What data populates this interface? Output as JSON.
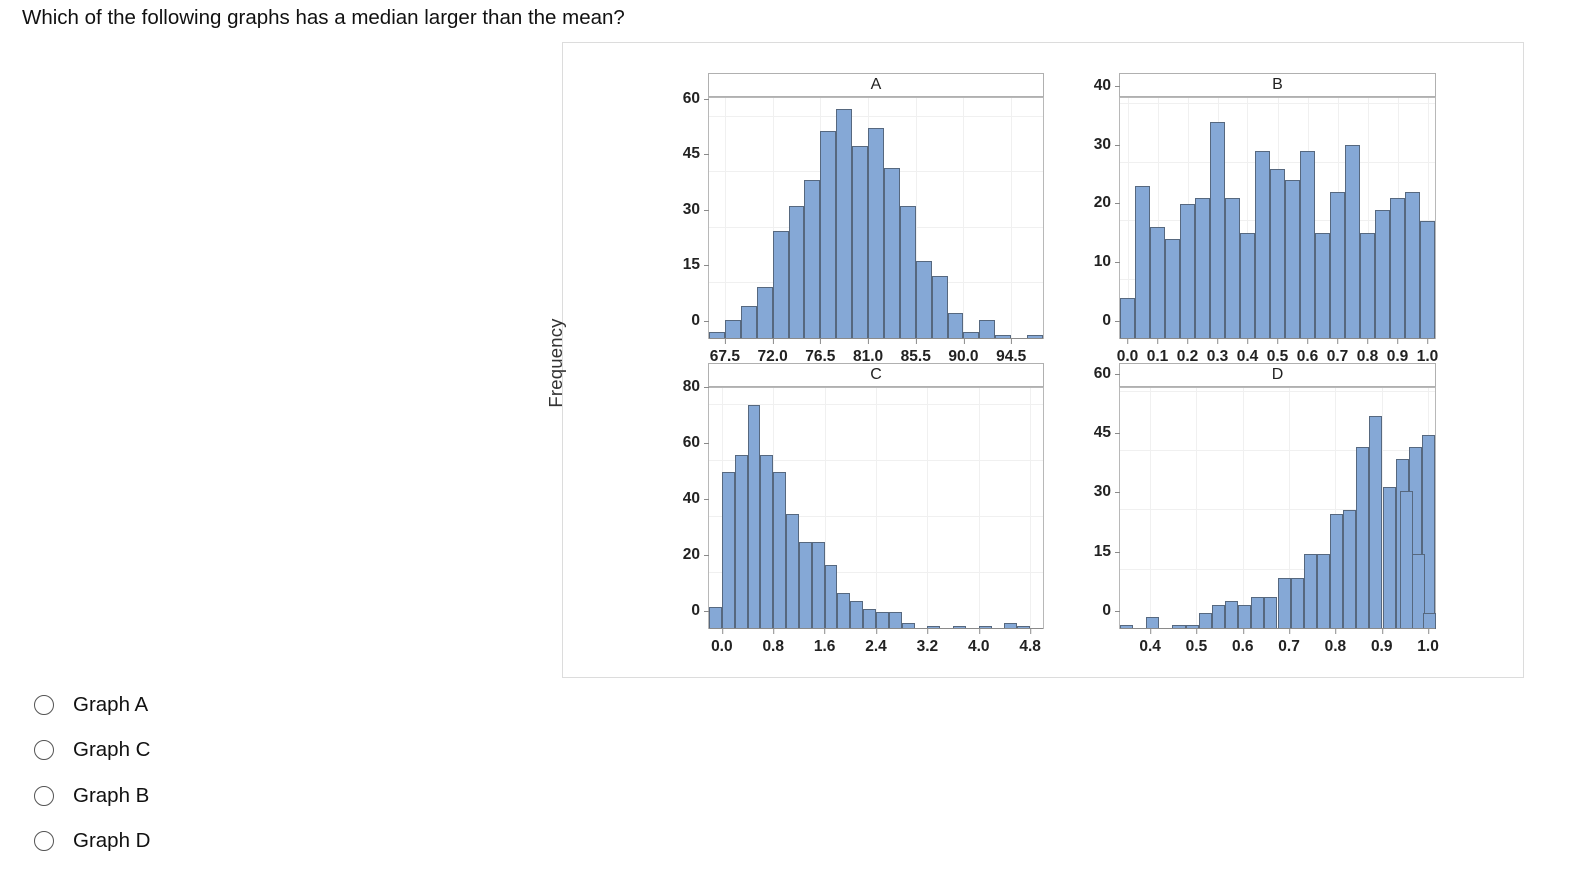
{
  "question": {
    "text": "Which of the following graphs has a median larger than the mean?"
  },
  "figure": {
    "y_axis_title": "Frequency"
  },
  "options": [
    {
      "label": "Graph A",
      "selected": false
    },
    {
      "label": "Graph C",
      "selected": false
    },
    {
      "label": "Graph B",
      "selected": false
    },
    {
      "label": "Graph D",
      "selected": false
    }
  ],
  "colors": {
    "bar_fill": "#85a8d6",
    "bar_stroke": "#56687f",
    "panel_border": "#dcdcdc",
    "grid": "#f0f0f0"
  },
  "chart_data": [
    {
      "type": "bar",
      "title": "A",
      "xlabel": "",
      "ylabel": "Frequency",
      "ylim": [
        0,
        65
      ],
      "yticks": [
        0,
        15,
        30,
        45,
        60
      ],
      "ytick_labels": [
        "0",
        "15",
        "30",
        "45",
        "60"
      ],
      "xlim": [
        66.0,
        97.5
      ],
      "xticks": [
        67.5,
        72.0,
        76.5,
        81.0,
        85.5,
        90.0,
        94.5
      ],
      "xtick_labels": [
        "67.5",
        "72.0",
        "76.5",
        "81.0",
        "85.5",
        "90.0",
        "94.5"
      ],
      "grid": true,
      "bin_width": 1.5,
      "bin_starts": [
        66.0,
        67.5,
        69.0,
        70.5,
        72.0,
        73.5,
        75.0,
        76.5,
        78.0,
        79.5,
        81.0,
        82.5,
        84.0,
        85.5,
        87.0,
        88.5,
        90.0,
        91.5,
        93.0,
        94.5,
        96.0
      ],
      "values": [
        2,
        5,
        9,
        14,
        29,
        36,
        43,
        56,
        62,
        52,
        57,
        46,
        36,
        21,
        17,
        7,
        2,
        5,
        1,
        0,
        1
      ]
    },
    {
      "type": "bar",
      "title": "B",
      "xlabel": "",
      "ylabel": "Frequency",
      "ylim": [
        0,
        41
      ],
      "yticks": [
        0,
        10,
        20,
        30,
        40
      ],
      "ytick_labels": [
        "0",
        "10",
        "20",
        "30",
        "40"
      ],
      "xlim": [
        -0.025,
        1.025
      ],
      "xticks": [
        0.0,
        0.1,
        0.2,
        0.3,
        0.4,
        0.5,
        0.6,
        0.7,
        0.8,
        0.9,
        1.0
      ],
      "xtick_labels": [
        "0.0",
        "0.1",
        "0.2",
        "0.3",
        "0.4",
        "0.5",
        "0.6",
        "0.7",
        "0.8",
        "0.9",
        "1.0"
      ],
      "grid": true,
      "bin_width": 0.05,
      "bin_starts": [
        -0.025,
        0.025,
        0.075,
        0.125,
        0.175,
        0.225,
        0.275,
        0.325,
        0.375,
        0.425,
        0.475,
        0.525,
        0.575,
        0.625,
        0.675,
        0.725,
        0.775,
        0.825,
        0.875,
        0.925,
        0.975
      ],
      "values": [
        7,
        26,
        19,
        17,
        23,
        24,
        37,
        24,
        18,
        32,
        29,
        27,
        32,
        18,
        25,
        33,
        18,
        22,
        24,
        25,
        20
      ]
    },
    {
      "type": "bar",
      "title": "C",
      "xlabel": "",
      "ylabel": "Frequency",
      "ylim": [
        0,
        86
      ],
      "yticks": [
        0,
        20,
        40,
        60,
        80
      ],
      "ytick_labels": [
        "0",
        "20",
        "40",
        "60",
        "80"
      ],
      "xlim": [
        -0.2,
        5.0
      ],
      "xticks": [
        0.0,
        0.8,
        1.6,
        2.4,
        3.2,
        4.0,
        4.8
      ],
      "xtick_labels": [
        "0.0",
        "0.8",
        "1.6",
        "2.4",
        "3.2",
        "4.0",
        "4.8"
      ],
      "grid": true,
      "bin_width": 0.2,
      "bin_starts": [
        -0.2,
        0.0,
        0.2,
        0.4,
        0.6,
        0.8,
        1.0,
        1.2,
        1.4,
        1.6,
        1.8,
        2.0,
        2.2,
        2.4,
        2.6,
        2.8,
        3.0,
        3.2,
        3.4,
        3.6,
        3.8,
        4.0,
        4.2,
        4.4,
        4.6
      ],
      "values": [
        8,
        56,
        62,
        80,
        62,
        56,
        41,
        31,
        31,
        23,
        13,
        10,
        7,
        6,
        6,
        2,
        0,
        1,
        0,
        1,
        0,
        1,
        0,
        2,
        1
      ]
    },
    {
      "type": "bar",
      "title": "D",
      "xlabel": "",
      "ylabel": "Frequency",
      "ylim": [
        0,
        61
      ],
      "yticks": [
        0,
        15,
        30,
        45,
        60
      ],
      "ytick_labels": [
        "0",
        "15",
        "30",
        "45",
        "60"
      ],
      "xlim": [
        0.335,
        1.015
      ],
      "xticks": [
        0.4,
        0.5,
        0.6,
        0.7,
        0.8,
        0.9,
        1.0
      ],
      "xtick_labels": [
        "0.4",
        "0.5",
        "0.6",
        "0.7",
        "0.8",
        "0.9",
        "1.0"
      ],
      "grid": true,
      "bin_width": 0.0283,
      "bin_starts": [
        0.335,
        0.3633,
        0.3917,
        0.42,
        0.4483,
        0.4767,
        0.505,
        0.5333,
        0.5617,
        0.59,
        0.6183,
        0.6467,
        0.675,
        0.7033,
        0.7317,
        0.76,
        0.7883,
        0.8167,
        0.845,
        0.8733,
        0.9017,
        0.93,
        0.9583,
        0.9867
      ],
      "values": [
        1,
        0,
        3,
        0,
        1,
        1,
        4,
        6,
        7,
        6,
        8,
        8,
        13,
        13,
        19,
        19,
        29,
        30,
        46,
        54,
        36,
        43,
        46,
        49,
        35,
        19,
        4
      ]
    }
  ]
}
